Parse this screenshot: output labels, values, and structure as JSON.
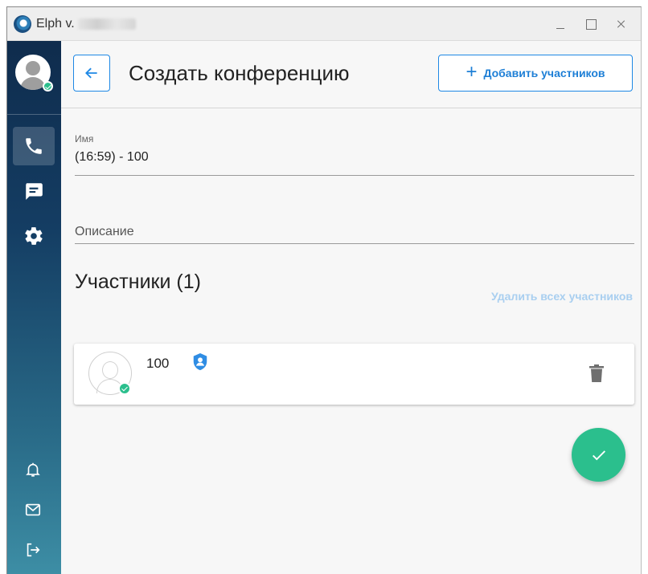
{
  "window": {
    "app_title": "Elph v.",
    "controls": [
      "minimize",
      "maximize",
      "close"
    ]
  },
  "sidebar": {
    "user_status": "online",
    "nav": [
      {
        "id": "calls",
        "icon": "phone-icon",
        "active": true
      },
      {
        "id": "chats",
        "icon": "chat-icon",
        "active": false
      },
      {
        "id": "settings",
        "icon": "gear-icon",
        "active": false
      }
    ],
    "bottom": [
      {
        "id": "notifications",
        "icon": "bell-icon"
      },
      {
        "id": "mail",
        "icon": "mail-icon"
      },
      {
        "id": "logout",
        "icon": "logout-icon"
      }
    ]
  },
  "header": {
    "title": "Создать конференцию",
    "add_participants_label": "Добавить участников"
  },
  "form": {
    "name_label": "Имя",
    "name_value": "(16:59) - 100",
    "description_placeholder": "Описание"
  },
  "participants": {
    "title": "Участники (1)",
    "remove_all_label": "Удалить всех участников",
    "list": [
      {
        "name": "100",
        "status": "online",
        "role_icon": "shield-user-icon"
      }
    ]
  },
  "colors": {
    "accent": "#1e88e5",
    "success": "#2bbf8d",
    "sidebar_top": "#0f2c4d",
    "sidebar_bottom": "#3d8ea5"
  }
}
